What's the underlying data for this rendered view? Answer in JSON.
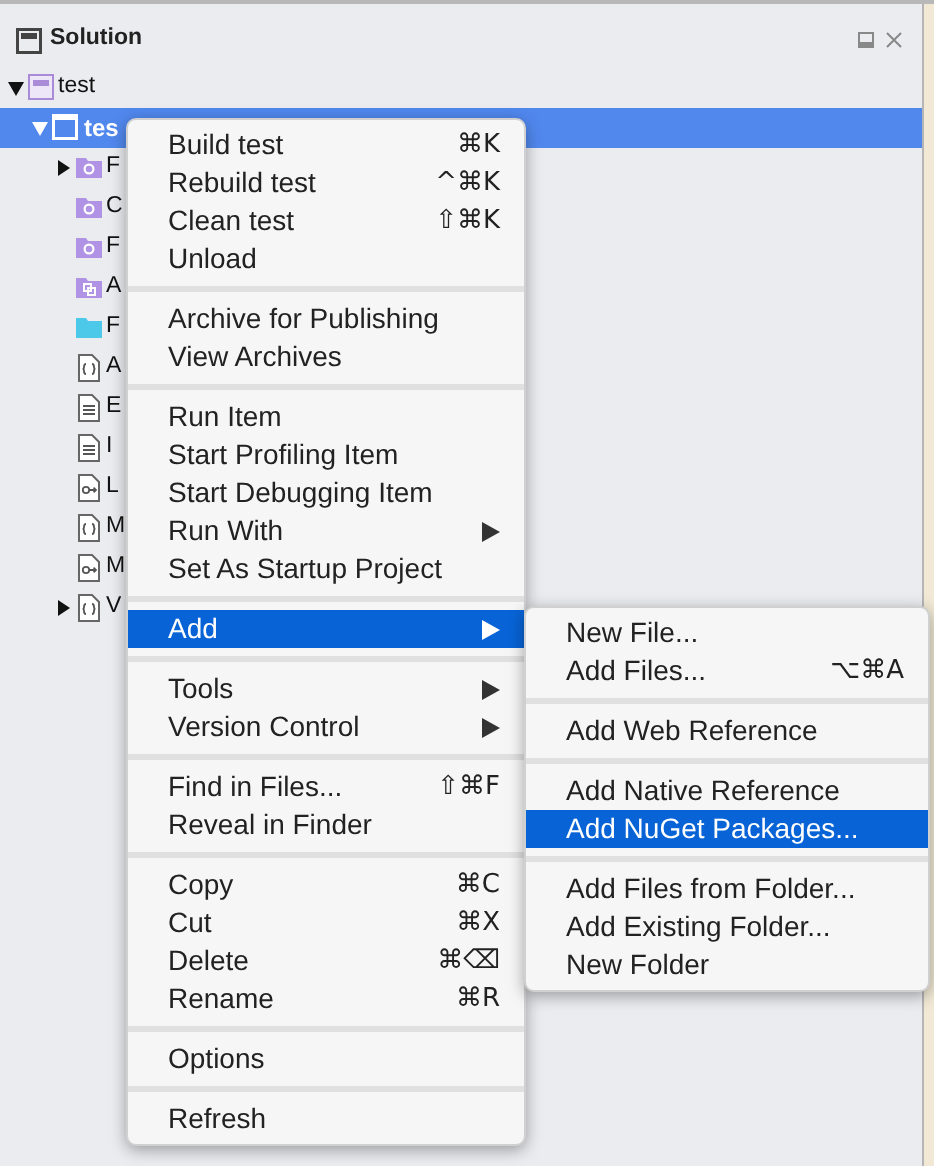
{
  "panel": {
    "title": "Solution"
  },
  "tree": [
    {
      "label": "test",
      "kind": "solution",
      "expanded": true,
      "selected": false,
      "children": [
        {
          "label": "tes",
          "kind": "project",
          "expanded": true,
          "selected": true,
          "children": [
            {
              "label": "F",
              "kind": "special-folder",
              "expanded": false,
              "selected": false
            },
            {
              "label": "C",
              "kind": "special-folder",
              "selected": false
            },
            {
              "label": "F",
              "kind": "special-folder",
              "selected": false
            },
            {
              "label": "A",
              "kind": "reference-folder",
              "selected": false
            },
            {
              "label": "F",
              "kind": "folder",
              "selected": false
            },
            {
              "label": "A",
              "kind": "code-file",
              "selected": false
            },
            {
              "label": "E",
              "kind": "text-file",
              "selected": false
            },
            {
              "label": "I",
              "kind": "text-file",
              "selected": false
            },
            {
              "label": "L",
              "kind": "link-file",
              "selected": false
            },
            {
              "label": "M",
              "kind": "code-file",
              "selected": false
            },
            {
              "label": "M",
              "kind": "link-file",
              "selected": false
            },
            {
              "label": "V",
              "kind": "code-file",
              "expanded": false,
              "selected": false
            }
          ]
        }
      ]
    }
  ],
  "context_menu": {
    "groups": [
      [
        {
          "label": "Build test",
          "shortcut": "⌘K",
          "submenu": false,
          "selected": false
        },
        {
          "label": "Rebuild test",
          "shortcut": "^⌘K",
          "submenu": false,
          "selected": false
        },
        {
          "label": "Clean test",
          "shortcut": "⇧⌘K",
          "submenu": false,
          "selected": false
        },
        {
          "label": "Unload",
          "submenu": false,
          "selected": false
        }
      ],
      [
        {
          "label": "Archive for Publishing",
          "submenu": false,
          "selected": false
        },
        {
          "label": "View Archives",
          "submenu": false,
          "selected": false
        }
      ],
      [
        {
          "label": "Run Item",
          "submenu": false,
          "selected": false
        },
        {
          "label": "Start Profiling Item",
          "submenu": false,
          "selected": false
        },
        {
          "label": "Start Debugging Item",
          "submenu": false,
          "selected": false
        },
        {
          "label": "Run With",
          "submenu": true,
          "selected": false
        },
        {
          "label": "Set As Startup Project",
          "submenu": false,
          "selected": false
        }
      ],
      [
        {
          "label": "Add",
          "submenu": true,
          "selected": true
        }
      ],
      [
        {
          "label": "Tools",
          "submenu": true,
          "selected": false
        },
        {
          "label": "Version Control",
          "submenu": true,
          "selected": false
        }
      ],
      [
        {
          "label": "Find in Files...",
          "shortcut": "⇧⌘F",
          "submenu": false,
          "selected": false
        },
        {
          "label": "Reveal in Finder",
          "submenu": false,
          "selected": false
        }
      ],
      [
        {
          "label": "Copy",
          "shortcut": "⌘C",
          "submenu": false,
          "selected": false
        },
        {
          "label": "Cut",
          "shortcut": "⌘X",
          "submenu": false,
          "selected": false
        },
        {
          "label": "Delete",
          "shortcut": "⌘⌫",
          "submenu": false,
          "selected": false
        },
        {
          "label": "Rename",
          "shortcut": "⌘R",
          "submenu": false,
          "selected": false
        }
      ],
      [
        {
          "label": "Options",
          "submenu": false,
          "selected": false
        }
      ],
      [
        {
          "label": "Refresh",
          "submenu": false,
          "selected": false
        }
      ]
    ]
  },
  "add_submenu": {
    "groups": [
      [
        {
          "label": "New File...",
          "selected": false
        },
        {
          "label": "Add Files...",
          "shortcut": "⌥⌘A",
          "selected": false
        }
      ],
      [
        {
          "label": "Add Web Reference",
          "selected": false
        }
      ],
      [
        {
          "label": "Add Native Reference",
          "selected": false
        },
        {
          "label": "Add NuGet Packages...",
          "selected": true
        }
      ],
      [
        {
          "label": "Add Files from Folder...",
          "selected": false
        },
        {
          "label": "Add Existing Folder...",
          "selected": false
        },
        {
          "label": "New Folder",
          "selected": false
        }
      ]
    ]
  }
}
